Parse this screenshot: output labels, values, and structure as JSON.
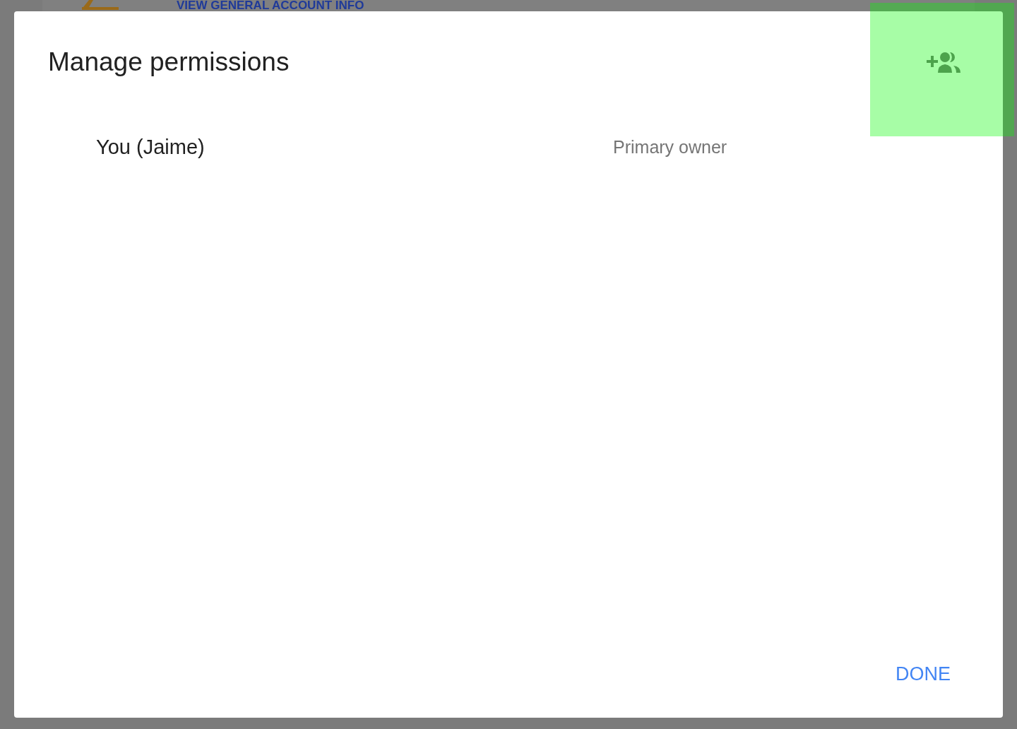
{
  "background": {
    "link": "VIEW GENERAL ACCOUNT INFO"
  },
  "dialog": {
    "title": "Manage permissions",
    "members": [
      {
        "name": "You (Jaime)",
        "role": "Primary owner"
      }
    ],
    "add_button": {
      "highlighted": true
    },
    "buttons": [
      "DONE"
    ]
  }
}
